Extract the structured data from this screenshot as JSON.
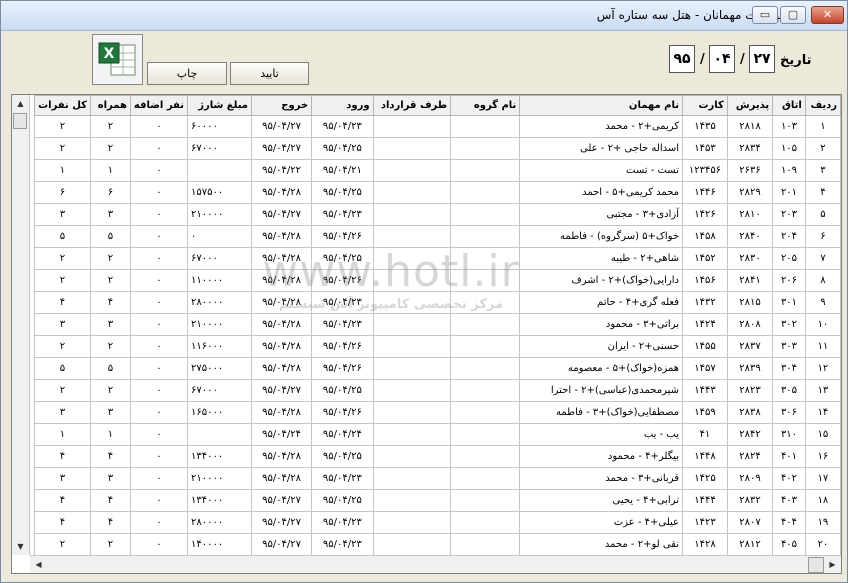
{
  "window": {
    "title": "فهرست مهمانان - هتل سه ستاره آس",
    "minimize_glyph": "▭",
    "maximize_glyph": "▢",
    "close_glyph": "✕"
  },
  "toolbar": {
    "excel_icon": "excel-export-icon",
    "print_label": "چاپ",
    "ok_label": "تایید"
  },
  "date": {
    "label": "تاریخ",
    "day": "۲۷",
    "month": "۰۴",
    "year": "۹۵",
    "separator": "/"
  },
  "watermark": {
    "line1": "www.hotl.ir",
    "line2": "مرکز تخصصی کامپیوتر آس سیستم"
  },
  "grid": {
    "columns": [
      "ردیف",
      "اتاق",
      "پذیرش",
      "کارت",
      "نام مهمان",
      "نام گروه",
      "طرف قرارداد",
      "ورود",
      "خروج",
      "مبلغ شارژ",
      "نفر اضافه",
      "همراه",
      "کل نفرات"
    ],
    "rows": [
      [
        "۱",
        "۱۰۳",
        "۲۸۱۸",
        "۱۴۳۵",
        "کریمی+۲ - محمد",
        "",
        "",
        "۹۵/۰۴/۲۳",
        "۹۵/۰۴/۲۷",
        "۶۰۰۰۰",
        "۰",
        "۲",
        "۲"
      ],
      [
        "۲",
        "۱۰۵",
        "۲۸۳۴",
        "۱۴۵۳",
        "اسداله حاجی +۲ - علی",
        "",
        "",
        "۹۵/۰۴/۲۵",
        "۹۵/۰۴/۲۷",
        "۶۷۰۰۰",
        "۰",
        "۲",
        "۲"
      ],
      [
        "۳",
        "۱۰۹",
        "۲۶۳۶",
        "۱۲۳۴۵۶",
        "تست - تست",
        "",
        "",
        "۹۵/۰۴/۲۱",
        "۹۵/۰۴/۲۲",
        "",
        "۰",
        "۱",
        "۱"
      ],
      [
        "۴",
        "۲۰۱",
        "۲۸۲۹",
        "۱۴۴۶",
        "محمد کریمی+۵ - احمد",
        "",
        "",
        "۹۵/۰۴/۲۵",
        "۹۵/۰۴/۲۸",
        "۱۵۷۵۰۰",
        "۰",
        "۶",
        "۶"
      ],
      [
        "۵",
        "۲۰۳",
        "۲۸۱۰",
        "۱۴۲۶",
        "آزادی+۳ - مجتبی",
        "",
        "",
        "۹۵/۰۴/۲۳",
        "۹۵/۰۴/۲۷",
        "۲۱۰۰۰۰",
        "۰",
        "۳",
        "۳"
      ],
      [
        "۶",
        "۲۰۴",
        "۲۸۴۰",
        "۱۴۵۸",
        "خواک+۵ (سرگروه) - فاطمه",
        "",
        "",
        "۹۵/۰۴/۲۶",
        "۹۵/۰۴/۲۸",
        "۰",
        "۰",
        "۵",
        "۵"
      ],
      [
        "۷",
        "۲۰۵",
        "۲۸۳۰",
        "۱۴۵۲",
        "شاهی+۲ - طیبه",
        "",
        "",
        "۹۵/۰۴/۲۵",
        "۹۵/۰۴/۲۸",
        "۶۷۰۰۰",
        "۰",
        "۲",
        "۲"
      ],
      [
        "۸",
        "۲۰۶",
        "۲۸۴۱",
        "۱۴۵۶",
        "دارایی(خواک)+۲ - اشرف",
        "",
        "",
        "۹۵/۰۴/۲۶",
        "۹۵/۰۴/۲۸",
        "۱۱۰۰۰۰",
        "۰",
        "۲",
        "۲"
      ],
      [
        "۹",
        "۳۰۱",
        "۲۸۱۵",
        "۱۴۳۲",
        "فعله گری+۴ - حاتم",
        "",
        "",
        "۹۵/۰۴/۲۳",
        "۹۵/۰۴/۲۸",
        "۲۸۰۰۰۰",
        "۰",
        "۴",
        "۴"
      ],
      [
        "۱۰",
        "۳۰۲",
        "۲۸۰۸",
        "۱۴۲۴",
        "براتی+۳ - محمود",
        "",
        "",
        "۹۵/۰۴/۲۳",
        "۹۵/۰۴/۲۸",
        "۲۱۰۰۰۰",
        "۰",
        "۳",
        "۳"
      ],
      [
        "۱۱",
        "۳۰۳",
        "۲۸۳۷",
        "۱۴۵۵",
        "حسنی+۲ - ایران",
        "",
        "",
        "۹۵/۰۴/۲۶",
        "۹۵/۰۴/۲۸",
        "۱۱۶۰۰۰",
        "۰",
        "۲",
        "۲"
      ],
      [
        "۱۲",
        "۳۰۴",
        "۲۸۳۹",
        "۱۴۵۷",
        "همزه(خواک)+۵ - معصومه",
        "",
        "",
        "۹۵/۰۴/۲۶",
        "۹۵/۰۴/۲۸",
        "۲۷۵۰۰۰",
        "۰",
        "۵",
        "۵"
      ],
      [
        "۱۳",
        "۳۰۵",
        "۲۸۲۳",
        "۱۴۴۳",
        "شیرمحمدی(عباسی)+۲ - احترا",
        "",
        "",
        "۹۵/۰۴/۲۵",
        "۹۵/۰۴/۲۷",
        "۶۷۰۰۰",
        "۰",
        "۲",
        "۲"
      ],
      [
        "۱۴",
        "۳۰۶",
        "۲۸۳۸",
        "۱۴۵۹",
        "مصطفایی(خواک)+۳ - فاطمه",
        "",
        "",
        "۹۵/۰۴/۲۶",
        "۹۵/۰۴/۲۸",
        "۱۶۵۰۰۰",
        "۰",
        "۳",
        "۳"
      ],
      [
        "۱۵",
        "۳۱۰",
        "۲۸۴۲",
        "۴۱",
        "یب - یب",
        "",
        "",
        "۹۵/۰۴/۲۴",
        "۹۵/۰۴/۲۴",
        "",
        "۰",
        "۱",
        "۱"
      ],
      [
        "۱۶",
        "۴۰۱",
        "۲۸۲۴",
        "۱۴۴۸",
        "بیگلر+۴ - محمود",
        "",
        "",
        "۹۵/۰۴/۲۵",
        "۹۵/۰۴/۲۸",
        "۱۳۴۰۰۰",
        "۰",
        "۴",
        "۴"
      ],
      [
        "۱۷",
        "۴۰۲",
        "۲۸۰۹",
        "۱۴۲۵",
        "قربانی+۳ - محمد",
        "",
        "",
        "۹۵/۰۴/۲۳",
        "۹۵/۰۴/۲۸",
        "۲۱۰۰۰۰",
        "۰",
        "۳",
        "۳"
      ],
      [
        "۱۸",
        "۴۰۳",
        "۲۸۳۲",
        "۱۴۴۴",
        "ترابی+۴ - یحیی",
        "",
        "",
        "۹۵/۰۴/۲۵",
        "۹۵/۰۴/۲۷",
        "۱۳۴۰۰۰",
        "۰",
        "۴",
        "۴"
      ],
      [
        "۱۹",
        "۴۰۴",
        "۲۸۰۷",
        "۱۴۲۳",
        "عیلی+۴ - عزت",
        "",
        "",
        "۹۵/۰۴/۲۳",
        "۹۵/۰۴/۲۷",
        "۲۸۰۰۰۰",
        "۰",
        "۴",
        "۴"
      ],
      [
        "۲۰",
        "۴۰۵",
        "۲۸۱۲",
        "۱۴۲۸",
        "نقی لو+۲ - محمد",
        "",
        "",
        "۹۵/۰۴/۲۳",
        "۹۵/۰۴/۲۷",
        "۱۴۰۰۰۰",
        "۰",
        "۲",
        "۲"
      ]
    ]
  }
}
